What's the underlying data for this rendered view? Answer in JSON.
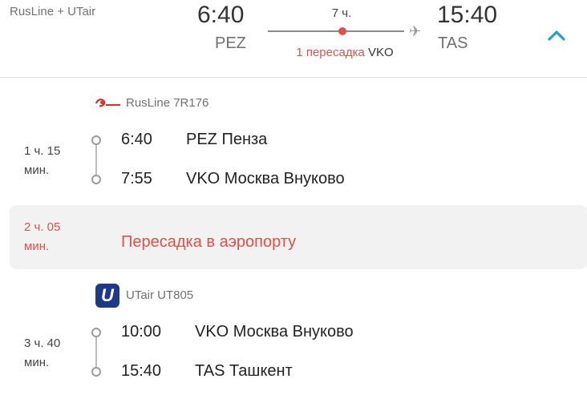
{
  "header": {
    "airlines": "RusLine + UTair",
    "depart_time": "6:40",
    "depart_code": "PEZ",
    "duration": "7 ч.",
    "transfer_count": "1 пересадка",
    "transfer_airport": "VKO",
    "arrive_time": "15:40",
    "arrive_code": "TAS",
    "collapse_icon": "chevron-up-icon"
  },
  "segments": [
    {
      "airline": "RusLine 7R176",
      "logo": "rusline-logo",
      "duration_line1": "1 ч. 15",
      "duration_line2": "мин.",
      "from_time": "6:40",
      "from_place": "PEZ Пенза",
      "to_time": "7:55",
      "to_place": "VKO Москва Внуково"
    },
    {
      "airline": "UTair UT805",
      "logo": "utair-logo",
      "logo_letter": "U",
      "duration_line1": "3 ч. 40",
      "duration_line2": "мин.",
      "from_time": "10:00",
      "from_place": "VKO Москва Внуково",
      "to_time": "15:40",
      "to_place": "TAS Ташкент"
    }
  ],
  "layover": {
    "duration_line1": "2 ч. 05",
    "duration_line2": "мин.",
    "text": "Пересадка в аэропорту"
  },
  "colors": {
    "accent": "#1fa3c4",
    "transfer_red": "#e0504a",
    "utair_blue": "#1d3a8a"
  }
}
